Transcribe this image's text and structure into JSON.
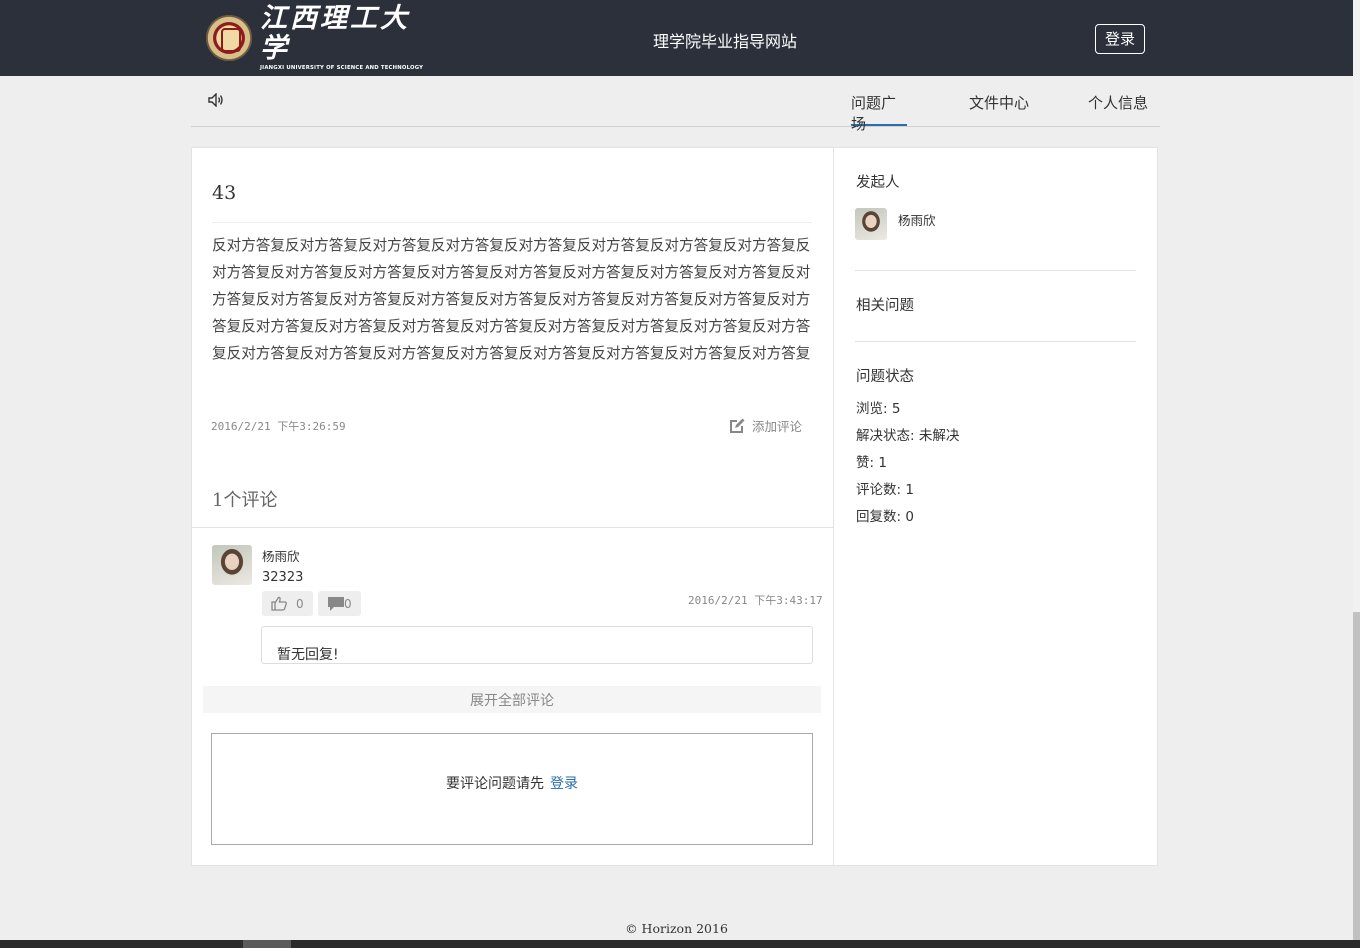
{
  "header": {
    "logo_cn": "江西理工大学",
    "logo_en": "JIANGXI UNIVERSITY OF SCIENCE AND TECHNOLOGY",
    "site_title": "理学院毕业指导网站",
    "login_label": "登录"
  },
  "nav": {
    "tabs": [
      {
        "label": "问题广场",
        "active": true
      },
      {
        "label": "文件中心",
        "active": false
      },
      {
        "label": "个人信息",
        "active": false
      }
    ]
  },
  "question": {
    "title": "43",
    "body": "反对方答复反对方答复反对方答复反对方答复反对方答复反对方答复反对方答复反对方答复反对方答复反对方答复反对方答复反对方答复反对方答复反对方答复反对方答复反对方答复反对方答复反对方答复反对方答复反对方答复反对方答复反对方答复反对方答复反对方答复反对方答复反对方答复反对方答复反对方答复反对方答复反对方答复反对方答复反对方答复反对方答复反对方答复反对方答复反对方答复反对方答复反对方答复反对方答复反对方答复反对方答复",
    "time": "2016/2/21 下午3:26:59",
    "add_comment": "添加评论"
  },
  "comments": {
    "title": "1个评论",
    "items": [
      {
        "author": "杨雨欣",
        "text": "32323",
        "time": "2016/2/21 下午3:43:17",
        "likes": "0",
        "replies": "0",
        "reply_placeholder": "暂无回复!"
      }
    ],
    "expand_label": "展开全部评论",
    "login_prompt": "要评论问题请先",
    "login_link": "登录"
  },
  "sidebar": {
    "initiator_heading": "发起人",
    "initiator_name": "杨雨欣",
    "related_heading": "相关问题",
    "status_heading": "问题状态",
    "stats": {
      "views": "浏览: 5",
      "resolve": "解决状态: 未解决",
      "likes": "赞: 1",
      "comments": "评论数: 1",
      "replies": "回复数: 0"
    }
  },
  "footer": {
    "text": "© Horizon 2016"
  },
  "colors": {
    "header_bg": "#2b303b",
    "accent": "#2a6ead",
    "page_bg": "#eeeeee"
  }
}
